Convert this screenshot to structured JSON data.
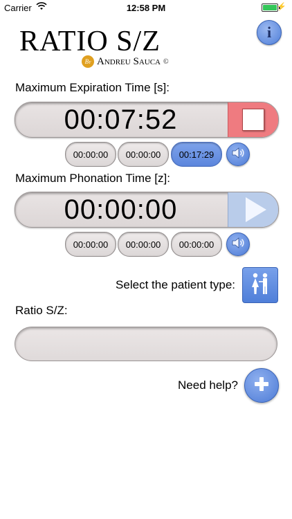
{
  "status": {
    "carrier": "Carrier",
    "time": "12:58 PM"
  },
  "logo": {
    "title": "RATIO S/Z",
    "by": "By",
    "author": "Andreu Sauca",
    "copyright": "©"
  },
  "expiration": {
    "label": "Maximum Expiration Time [s]:",
    "timer": "00:07:52",
    "laps": [
      "00:00:00",
      "00:00:00",
      "00:17:29"
    ]
  },
  "phonation": {
    "label": "Maximum Phonation Time [z]:",
    "timer": "00:00:00",
    "laps": [
      "00:00:00",
      "00:00:00",
      "00:00:00"
    ]
  },
  "patient": {
    "label": "Select the patient type:"
  },
  "ratio": {
    "label": "Ratio S/Z:",
    "value": ""
  },
  "help": {
    "label": "Need help?"
  },
  "icons": {
    "info": "info-icon",
    "stop": "stop-icon",
    "play": "play-icon",
    "speaker": "speaker-icon",
    "patient": "people-icon",
    "help": "plus-icon"
  },
  "colors": {
    "accent": "#5c86dd",
    "stop": "#ef7b80",
    "play": "#b9ccea"
  }
}
